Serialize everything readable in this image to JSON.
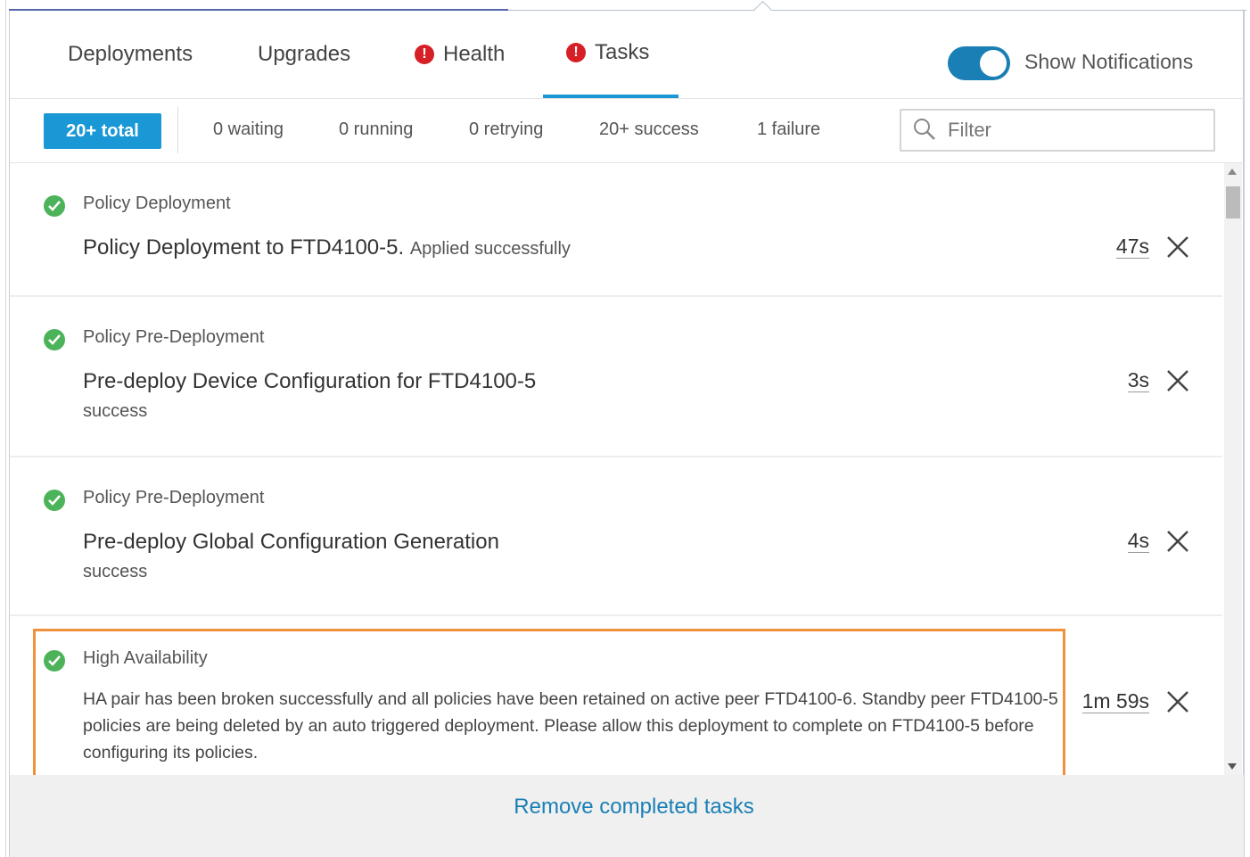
{
  "tabs": [
    {
      "label": "Deployments",
      "alert": false,
      "active": false
    },
    {
      "label": "Upgrades",
      "alert": false,
      "active": false
    },
    {
      "label": "Health",
      "alert": true,
      "active": false
    },
    {
      "label": "Tasks",
      "alert": true,
      "active": true
    }
  ],
  "notifications": {
    "label": "Show Notifications",
    "enabled": true
  },
  "filters": {
    "total": "20+ total",
    "waiting": "0 waiting",
    "running": "0 running",
    "retrying": "0 retrying",
    "success": "20+ success",
    "failure": "1 failure",
    "search_placeholder": "Filter"
  },
  "tasks": [
    {
      "status": "success",
      "category": "Policy Deployment",
      "message": "Policy Deployment to FTD4100-5.",
      "detail": "Applied successfully",
      "duration": "47s"
    },
    {
      "status": "success",
      "category": "Policy Pre-Deployment",
      "message": "Pre-deploy Device Configuration for FTD4100-5",
      "sub": "success",
      "duration": "3s"
    },
    {
      "status": "success",
      "category": "Policy Pre-Deployment",
      "message": "Pre-deploy Global Configuration Generation",
      "sub": "success",
      "duration": "4s"
    },
    {
      "status": "success",
      "category": "High Availability",
      "message": "HA pair has been broken successfully and all policies have been retained on active peer FTD4100-6. Standby peer FTD4100-5 policies are being deleted by an auto triggered deployment. Please allow this deployment to complete on FTD4100-5 before configuring its policies.",
      "duration": "1m 59s",
      "highlighted": true
    }
  ],
  "footer": {
    "remove_label": "Remove completed tasks"
  },
  "colors": {
    "accent": "#1a98d6",
    "toggle": "#1a7fb5",
    "success": "#4db35a",
    "error": "#d61f26",
    "highlight_border": "#f0923d"
  }
}
